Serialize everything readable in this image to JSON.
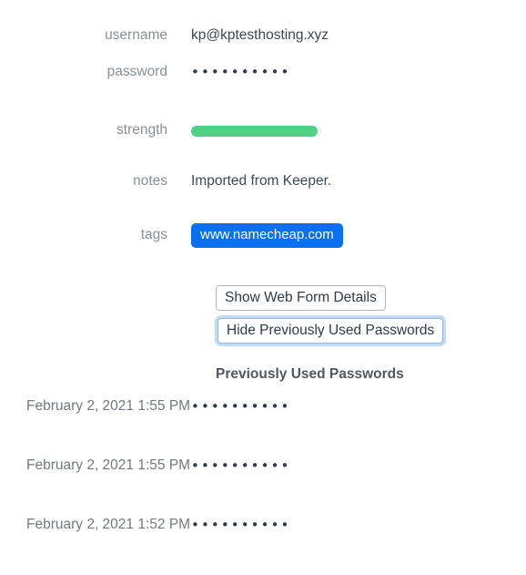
{
  "fields": {
    "username": {
      "label": "username",
      "value": "kp@kptesthosting.xyz"
    },
    "password": {
      "label": "password",
      "value": "••••••••••"
    },
    "strength": {
      "label": "strength",
      "percent": 97,
      "color": "#4ed185"
    },
    "notes": {
      "label": "notes",
      "value": "Imported from Keeper."
    },
    "tags": {
      "label": "tags",
      "value": "www.namecheap.com",
      "color": "#0a70f2"
    }
  },
  "buttons": {
    "show_web_form": "Show Web Form Details",
    "hide_previously_used": "Hide Previously Used Passwords",
    "focus_ring_color": "#bcdcfa"
  },
  "history": {
    "heading": "Previously Used Passwords",
    "rows": [
      {
        "date": "February 2, 2021 1:55 PM",
        "password": "••••••••••"
      },
      {
        "date": "February 2, 2021 1:55 PM",
        "password": "••••••••••"
      },
      {
        "date": "February 2, 2021 1:52 PM",
        "password": "••••••••••"
      }
    ]
  }
}
